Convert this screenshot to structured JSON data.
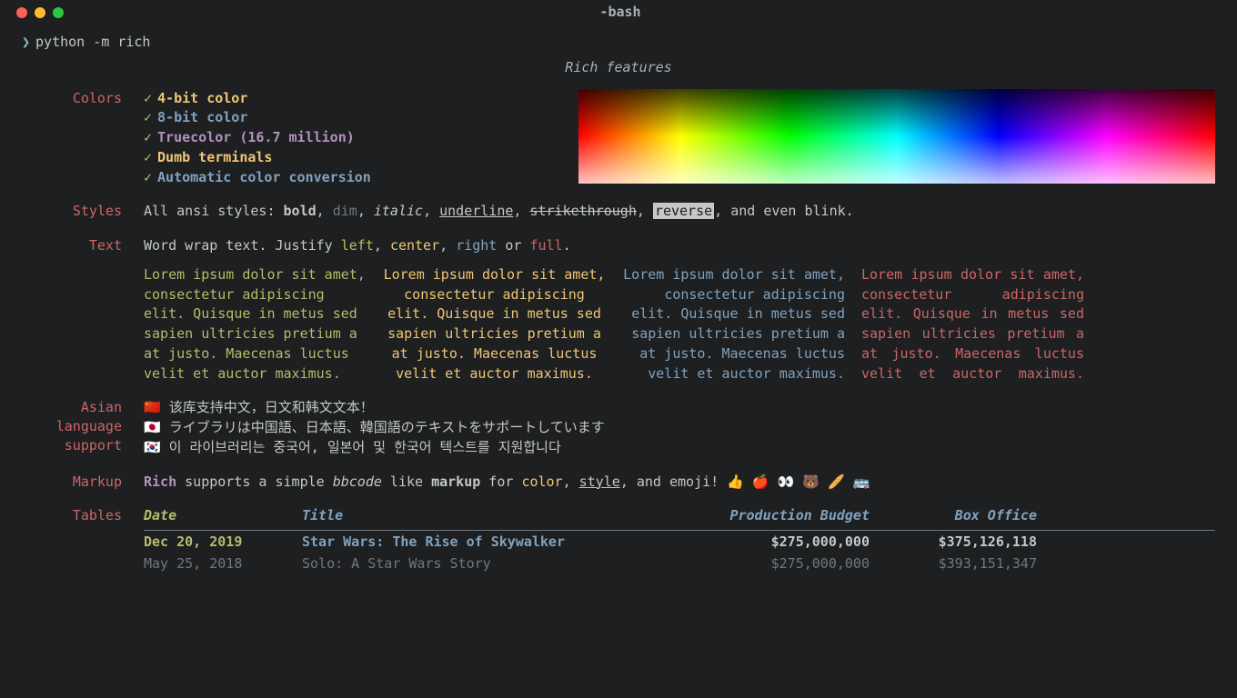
{
  "titlebar": {
    "title": "-bash"
  },
  "prompt": {
    "caret": "❯",
    "command": "python -m rich"
  },
  "heading": "Rich features",
  "sections": {
    "colors": {
      "label": "Colors",
      "items": [
        "4-bit color",
        "8-bit color",
        "Truecolor (16.7 million)",
        "Dumb terminals",
        "Automatic color conversion"
      ]
    },
    "styles": {
      "label": "Styles",
      "lead": "All ansi styles: ",
      "bold": "bold",
      "dim": "dim",
      "italic": "italic",
      "underline": "underline",
      "strike": "strikethrough",
      "reverse": "reverse",
      "tail": ", and even blink."
    },
    "text": {
      "label": "Text",
      "lead": "Word wrap text. Justify ",
      "left": "left",
      "center": "center",
      "right": "right",
      "or": " or ",
      "full": "full",
      "period": ".",
      "lorem": "Lorem ipsum dolor sit amet, consectetur adipiscing elit. Quisque in metus sed sapien ultricies pretium a at justo. Maecenas luctus velit et auctor maximus."
    },
    "asian": {
      "label": "Asian language support",
      "lines": [
        "🇨🇳 该库支持中文，日文和韩文文本！",
        "🇯🇵 ライブラリは中国語、日本語、韓国語のテキストをサポートしています",
        "🇰🇷 이 라이브러리는 중국어, 일본어 및 한국어 텍스트를 지원합니다"
      ]
    },
    "markup": {
      "label": "Markup",
      "rich": "Rich",
      "t1": " supports a simple ",
      "bbcode": "bbcode",
      "t2": " like ",
      "mk": "markup",
      "t3": " for ",
      "color": "color",
      "sep": ", ",
      "style": "style",
      "t4": ", and emoji! ",
      "emoji": "👍 🍎 👀 🐻 🥖 🚌"
    },
    "tables": {
      "label": "Tables",
      "headers": {
        "date": "Date",
        "title": "Title",
        "budget": "Production Budget",
        "box": "Box Office"
      },
      "rows": [
        {
          "date": "Dec 20, 2019",
          "title": "Star Wars: The Rise of Skywalker",
          "budget": "$275,000,000",
          "box": "$375,126,118"
        },
        {
          "date": "May 25, 2018",
          "title": "Solo: A Star Wars Story",
          "budget": "$275,000,000",
          "box": "$393,151,347"
        }
      ]
    }
  }
}
